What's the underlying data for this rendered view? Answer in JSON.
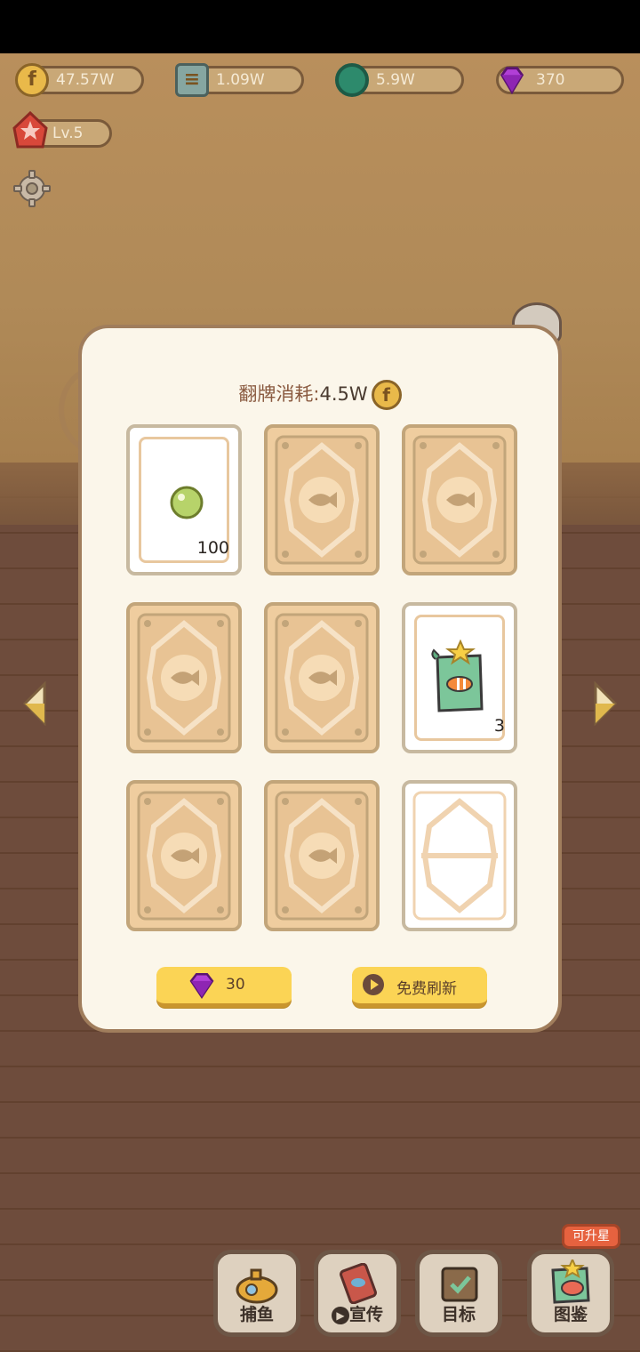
{
  "resources": {
    "coins": "47.57W",
    "books": "1.09W",
    "rings": "5.9W",
    "gems": "370"
  },
  "player": {
    "level": "Lv.5"
  },
  "flip_panel": {
    "cost_label": "翻牌消耗:",
    "cost_value": "4.5W",
    "cards": [
      {
        "state": "open",
        "item": "pearl-icon",
        "count": "100"
      },
      {
        "state": "back"
      },
      {
        "state": "back"
      },
      {
        "state": "back"
      },
      {
        "state": "back"
      },
      {
        "state": "open",
        "item": "fish-scroll-icon",
        "count": "3"
      },
      {
        "state": "back"
      },
      {
        "state": "back"
      },
      {
        "state": "empty"
      }
    ],
    "gem_button_value": "30",
    "free_refresh_label": "免费刷新"
  },
  "bottom_nav": {
    "fishing": "捕鱼",
    "promote": "宣传",
    "goals": "目标",
    "collection": "图鉴",
    "upgrade_badge": "可升星"
  },
  "colors": {
    "panel_bg": "#fbf6ea",
    "button_yellow": "#fbd455",
    "gem_purple": "#b13fd6",
    "coin_gold": "#e9b94a"
  }
}
